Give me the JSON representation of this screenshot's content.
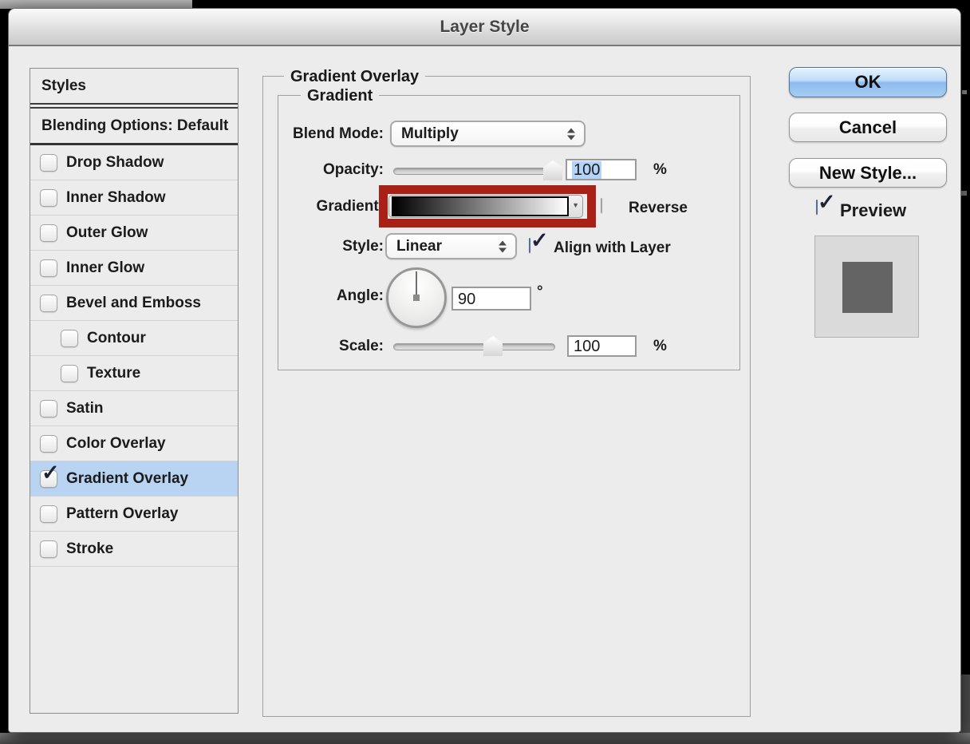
{
  "window": {
    "title": "Layer Style"
  },
  "sidebar": {
    "header": "Styles",
    "blending_options": "Blending Options: Default",
    "items": [
      {
        "label": "Drop Shadow",
        "checked": false,
        "indent": false,
        "selected": false
      },
      {
        "label": "Inner Shadow",
        "checked": false,
        "indent": false,
        "selected": false
      },
      {
        "label": "Outer Glow",
        "checked": false,
        "indent": false,
        "selected": false
      },
      {
        "label": "Inner Glow",
        "checked": false,
        "indent": false,
        "selected": false
      },
      {
        "label": "Bevel and Emboss",
        "checked": false,
        "indent": false,
        "selected": false
      },
      {
        "label": "Contour",
        "checked": false,
        "indent": true,
        "selected": false
      },
      {
        "label": "Texture",
        "checked": false,
        "indent": true,
        "selected": false
      },
      {
        "label": "Satin",
        "checked": false,
        "indent": false,
        "selected": false
      },
      {
        "label": "Color Overlay",
        "checked": false,
        "indent": false,
        "selected": false
      },
      {
        "label": "Gradient Overlay",
        "checked": true,
        "indent": false,
        "selected": true
      },
      {
        "label": "Pattern Overlay",
        "checked": false,
        "indent": false,
        "selected": false
      },
      {
        "label": "Stroke",
        "checked": false,
        "indent": false,
        "selected": false
      }
    ]
  },
  "panel": {
    "legend": "Gradient Overlay",
    "group_legend": "Gradient",
    "blend_mode": {
      "label": "Blend Mode:",
      "value": "Multiply"
    },
    "opacity": {
      "label": "Opacity:",
      "value": "100",
      "unit": "%",
      "slider_percent": 100,
      "value_selected": true
    },
    "gradient": {
      "label": "Gradient:",
      "swatch": "black-to-white",
      "reverse_label": "Reverse",
      "reverse_checked": false
    },
    "style": {
      "label": "Style:",
      "value": "Linear",
      "align_label": "Align with Layer",
      "align_checked": true
    },
    "angle": {
      "label": "Angle:",
      "value": "90",
      "unit": "°",
      "degrees": 90
    },
    "scale": {
      "label": "Scale:",
      "value": "100",
      "unit": "%",
      "slider_percent": 62
    }
  },
  "actions": {
    "ok_label": "OK",
    "cancel_label": "Cancel",
    "new_style_label": "New Style...",
    "preview_label": "Preview",
    "preview_checked": true
  },
  "annotation": {
    "type": "highlight-rectangle",
    "target": "gradient-swatch",
    "color": "#A92016"
  },
  "icons": {
    "check": "✓",
    "gradient_picker_arrow": "▼"
  },
  "colors": {
    "dialog_bg": "#ECECEC",
    "selected_row": "#B9D4F2",
    "ok_button_blue": "#8CBAEF",
    "annotation_red": "#A92016",
    "text_selection": "#B3D3F9",
    "preview_square": "#646464"
  }
}
